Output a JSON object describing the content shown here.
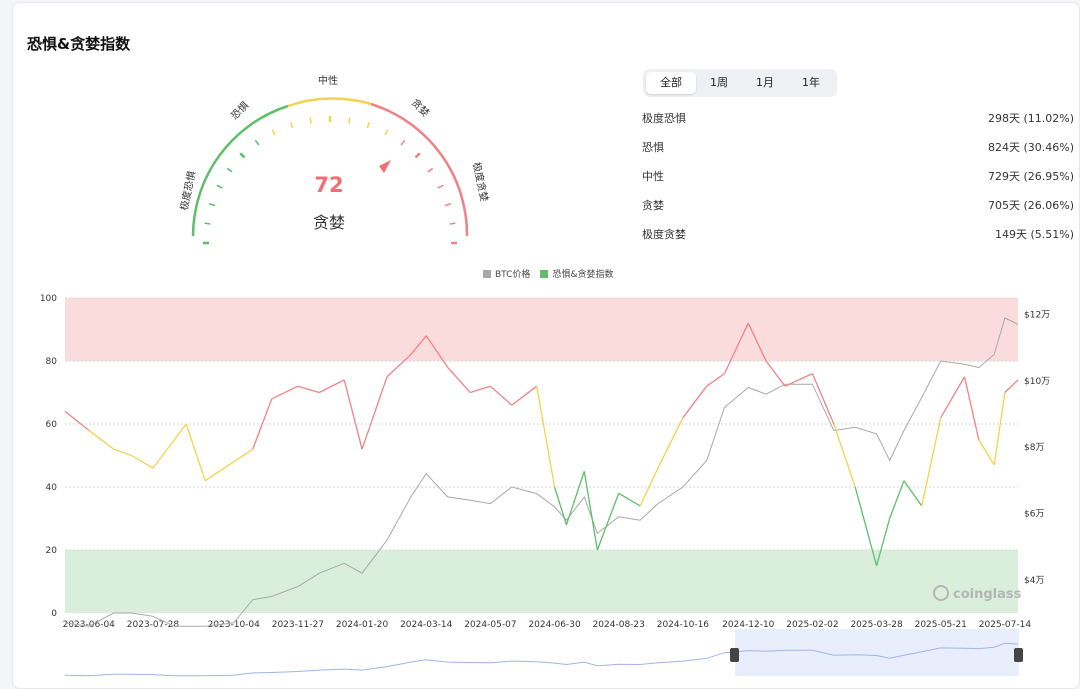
{
  "card": {
    "title": "恐惧&贪婪指数"
  },
  "gauge": {
    "value": "72",
    "value_label": "贪婪",
    "labels": [
      "极度恐惧",
      "恐惧",
      "中性",
      "贪婪",
      "极度贪婪"
    ],
    "colors": {
      "green": "#5cbf6a",
      "yellow": "#f1d34c",
      "red": "#f08286",
      "value": "#ef6f72"
    }
  },
  "tabs": [
    {
      "label": "全部",
      "active": true
    },
    {
      "label": "1周",
      "active": false
    },
    {
      "label": "1月",
      "active": false
    },
    {
      "label": "1年",
      "active": false
    }
  ],
  "stats": [
    {
      "label": "极度恐惧",
      "value": "298天 (11.02%)"
    },
    {
      "label": "恐惧",
      "value": "824天 (30.46%)"
    },
    {
      "label": "中性",
      "value": "729天 (26.95%)"
    },
    {
      "label": "贪婪",
      "value": "705天 (26.06%)"
    },
    {
      "label": "极度贪婪",
      "value": "149天 (5.51%)"
    }
  ],
  "watermark": "coinglass",
  "chart_data": {
    "type": "line",
    "legend": [
      "BTC价格",
      "恐惧&贪婪指数"
    ],
    "colors": {
      "btc": "#a8a8a8",
      "greed_zone": "#fbdcdd",
      "fear_zone": "#d9efdc",
      "green": "#5cbf6a",
      "yellow": "#f1d34c",
      "red": "#f08286",
      "navigator": "#9fb5e8"
    },
    "x_ticks": [
      "2023-06-04",
      "2023-07-28",
      "2023-10-04",
      "2023-11-27",
      "2024-01-20",
      "2024-03-14",
      "2024-05-07",
      "2024-06-30",
      "2024-08-23",
      "2024-10-16",
      "2024-12-10",
      "2025-02-02",
      "2025-03-28",
      "2025-05-21",
      "2025-07-14"
    ],
    "left_ticks": [
      "0",
      "20",
      "40",
      "60",
      "80",
      "100"
    ],
    "right_ticks": [
      "$4万",
      "$6万",
      "$8万",
      "$10万",
      "$12万"
    ],
    "ylim_index": [
      0,
      100
    ],
    "ylim_price_wan": [
      3,
      12.5
    ],
    "bands": [
      {
        "from": 80,
        "to": 100,
        "zone": "greed"
      },
      {
        "from": 0,
        "to": 20,
        "zone": "fear"
      }
    ],
    "x": [
      "2023-05-15",
      "2023-06-04",
      "2023-06-25",
      "2023-07-10",
      "2023-07-28",
      "2023-08-15",
      "2023-08-25",
      "2023-09-10",
      "2023-10-04",
      "2023-10-20",
      "2023-11-05",
      "2023-11-27",
      "2023-12-15",
      "2024-01-05",
      "2024-01-20",
      "2024-02-10",
      "2024-03-01",
      "2024-03-14",
      "2024-04-01",
      "2024-04-20",
      "2024-05-07",
      "2024-05-25",
      "2024-06-15",
      "2024-06-30",
      "2024-07-10",
      "2024-07-25",
      "2024-08-05",
      "2024-08-23",
      "2024-09-10",
      "2024-09-25",
      "2024-10-16",
      "2024-11-05",
      "2024-11-20",
      "2024-12-10",
      "2024-12-25",
      "2025-01-10",
      "2025-02-02",
      "2025-02-20",
      "2025-03-10",
      "2025-03-28",
      "2025-04-08",
      "2025-04-20",
      "2025-05-05",
      "2025-05-21",
      "2025-06-10",
      "2025-06-22",
      "2025-07-05",
      "2025-07-14",
      "2025-07-25"
    ],
    "series": [
      {
        "name": "恐惧&贪婪指数",
        "values": [
          64,
          58,
          52,
          50,
          46,
          55,
          60,
          42,
          48,
          52,
          68,
          72,
          70,
          74,
          52,
          75,
          82,
          88,
          78,
          70,
          72,
          66,
          72,
          40,
          28,
          45,
          20,
          38,
          34,
          46,
          62,
          72,
          76,
          92,
          80,
          72,
          76,
          60,
          40,
          15,
          30,
          42,
          34,
          62,
          75,
          55,
          47,
          70,
          74
        ]
      },
      {
        "name": "BTC价格",
        "values": [
          2.7,
          2.6,
          3.0,
          3.0,
          2.9,
          2.6,
          2.6,
          2.6,
          2.7,
          3.4,
          3.5,
          3.8,
          4.2,
          4.5,
          4.2,
          5.2,
          6.5,
          7.2,
          6.5,
          6.4,
          6.3,
          6.8,
          6.6,
          6.2,
          5.8,
          6.5,
          5.4,
          5.9,
          5.8,
          6.3,
          6.8,
          7.6,
          9.2,
          9.8,
          9.6,
          9.9,
          9.9,
          8.5,
          8.6,
          8.4,
          7.6,
          8.5,
          9.5,
          10.6,
          10.5,
          10.4,
          10.8,
          11.9,
          11.7
        ]
      }
    ]
  }
}
